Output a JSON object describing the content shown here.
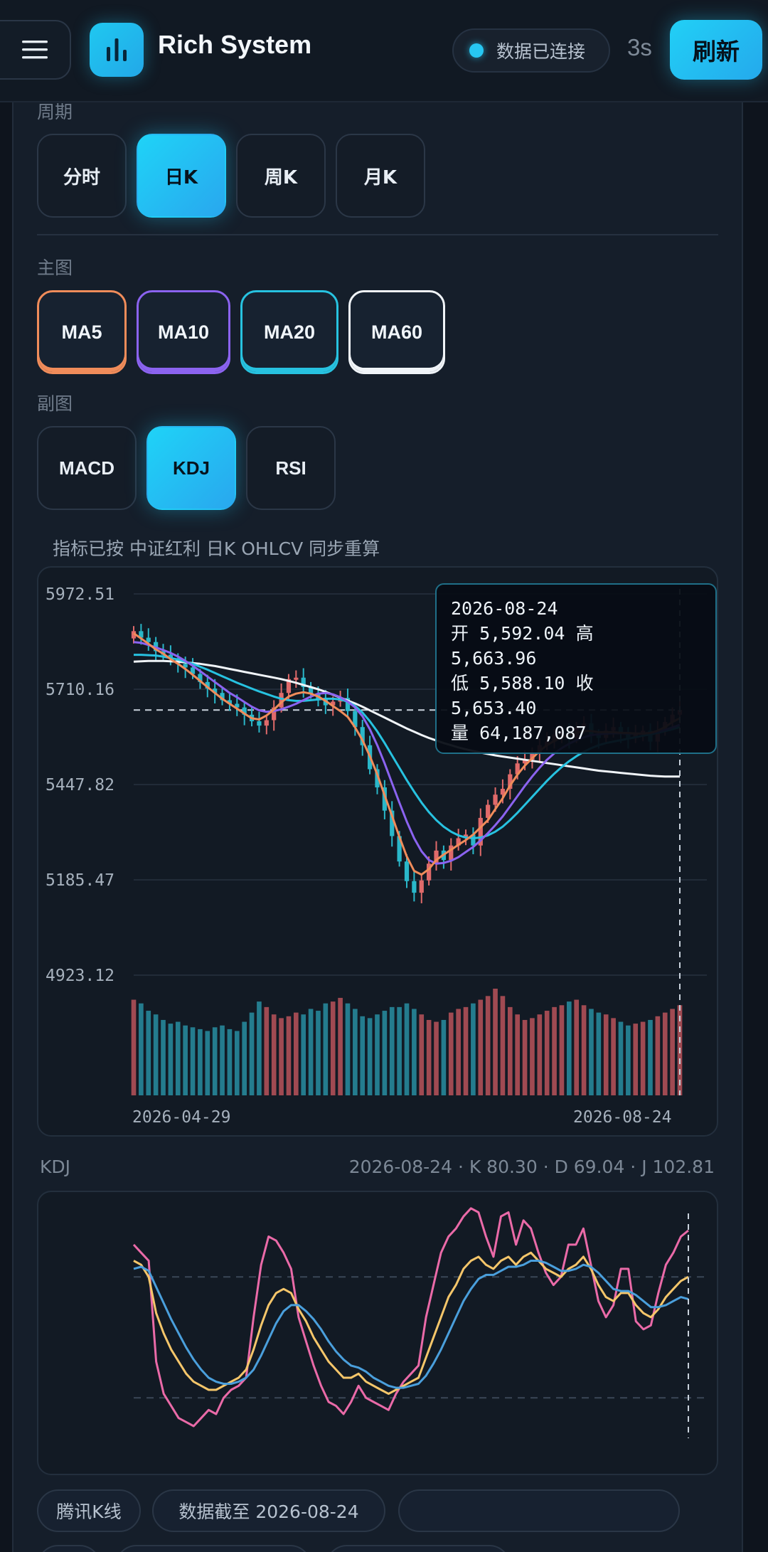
{
  "header": {
    "title": "Rich System",
    "connection_status": "数据已连接",
    "countdown": "3s",
    "refresh_label": "刷新",
    "menu_icon": "hamburger-icon",
    "logo_icon": "bar-chart-icon"
  },
  "period": {
    "label": "周期",
    "options": [
      "分时",
      "日K",
      "周K",
      "月K"
    ],
    "selected": "日K"
  },
  "main_chart": {
    "label": "主图",
    "overlays": [
      {
        "label": "MA5",
        "color": "#f08c5a"
      },
      {
        "label": "MA10",
        "color": "#8b63f0"
      },
      {
        "label": "MA20",
        "color": "#27c2e0"
      },
      {
        "label": "MA60",
        "color": "#f0f4f8"
      }
    ]
  },
  "sub_chart": {
    "label": "副图",
    "options": [
      "MACD",
      "KDJ",
      "RSI"
    ],
    "selected": "KDJ"
  },
  "note": "指标已按 中证红利 日K OHLCV 同步重算",
  "tooltip": {
    "date": "2026-08-24",
    "open_label": "开",
    "open": "5,592.04",
    "high_label": "高",
    "high": "5,663.96",
    "low_label": "低",
    "low": "5,588.10",
    "close_label": "收",
    "close": "5,653.40",
    "volume_label": "量",
    "volume": "64,187,087"
  },
  "kdj": {
    "label": "KDJ",
    "summary": "2026-08-24 · K 80.30 · D 69.04 · J 102.81"
  },
  "footer": {
    "pills": [
      "腾讯K线",
      "数据截至 2026-08-24",
      ""
    ]
  },
  "chart_data": [
    {
      "type": "candlestick",
      "y_ticks": [
        "5972.51",
        "5710.16",
        "5447.82",
        "5185.47",
        "4923.12"
      ],
      "ylim": [
        4923.12,
        5972.51
      ],
      "x_labels": [
        "2026-04-29",
        "2026-08-24"
      ],
      "colors": {
        "up": "#e06a6a",
        "down": "#2ab7c9",
        "ma5": "#f08c5a",
        "ma10": "#8b63f0",
        "ma20": "#27c2e0",
        "ma60": "#f0f4f8"
      },
      "close": [
        5870,
        5852,
        5840,
        5815,
        5805,
        5795,
        5780,
        5770,
        5752,
        5730,
        5712,
        5700,
        5680,
        5670,
        5660,
        5640,
        5622,
        5610,
        5625,
        5660,
        5700,
        5738,
        5742,
        5716,
        5698,
        5682,
        5666,
        5676,
        5686,
        5650,
        5606,
        5556,
        5490,
        5440,
        5376,
        5306,
        5236,
        5182,
        5150,
        5184,
        5230,
        5266,
        5240,
        5280,
        5300,
        5310,
        5280,
        5356,
        5392,
        5420,
        5436,
        5476,
        5506,
        5516,
        5536,
        5556,
        5566,
        5586,
        5590,
        5576,
        5606,
        5616,
        5586,
        5576,
        5596,
        5606,
        5586,
        5576,
        5586,
        5596,
        5566,
        5596,
        5620,
        5640,
        5653
      ],
      "ma5": [
        5864,
        5850,
        5835,
        5820,
        5808,
        5793,
        5780,
        5766,
        5750,
        5733,
        5716,
        5700,
        5684,
        5670,
        5657,
        5643,
        5630,
        5627,
        5638,
        5654,
        5674,
        5690,
        5698,
        5702,
        5698,
        5690,
        5678,
        5664,
        5650,
        5634,
        5605,
        5570,
        5526,
        5476,
        5418,
        5362,
        5304,
        5250,
        5210,
        5200,
        5215,
        5240,
        5255,
        5268,
        5282,
        5295,
        5310,
        5330,
        5350,
        5380,
        5410,
        5445,
        5475,
        5500,
        5520,
        5540,
        5556,
        5568,
        5578,
        5584,
        5590,
        5595,
        5595,
        5592,
        5592,
        5592,
        5590,
        5590,
        5588,
        5588,
        5590,
        5596,
        5606,
        5620,
        5630
      ],
      "ma10": [
        5840,
        5838,
        5832,
        5825,
        5818,
        5810,
        5800,
        5788,
        5775,
        5760,
        5745,
        5730,
        5715,
        5700,
        5688,
        5675,
        5662,
        5652,
        5648,
        5650,
        5655,
        5662,
        5670,
        5680,
        5690,
        5698,
        5700,
        5696,
        5688,
        5676,
        5660,
        5636,
        5600,
        5556,
        5506,
        5452,
        5398,
        5346,
        5300,
        5264,
        5240,
        5230,
        5232,
        5238,
        5248,
        5262,
        5276,
        5294,
        5314,
        5336,
        5360,
        5388,
        5416,
        5444,
        5470,
        5494,
        5516,
        5534,
        5548,
        5560,
        5570,
        5578,
        5584,
        5586,
        5588,
        5589,
        5589,
        5588,
        5588,
        5588,
        5590,
        5593,
        5598,
        5605,
        5612
      ],
      "ma20": [
        5805,
        5805,
        5804,
        5803,
        5800,
        5796,
        5792,
        5786,
        5780,
        5772,
        5764,
        5755,
        5746,
        5737,
        5728,
        5720,
        5712,
        5704,
        5697,
        5690,
        5684,
        5680,
        5678,
        5678,
        5680,
        5682,
        5684,
        5684,
        5682,
        5676,
        5664,
        5646,
        5622,
        5594,
        5562,
        5528,
        5494,
        5460,
        5428,
        5398,
        5372,
        5350,
        5332,
        5318,
        5308,
        5302,
        5300,
        5302,
        5308,
        5318,
        5332,
        5350,
        5370,
        5392,
        5414,
        5436,
        5458,
        5478,
        5496,
        5512,
        5526,
        5538,
        5548,
        5556,
        5562,
        5566,
        5570,
        5574,
        5578,
        5582,
        5586,
        5590,
        5595,
        5600,
        5606
      ],
      "ma60": [
        5786,
        5787,
        5788,
        5788,
        5788,
        5787,
        5786,
        5784,
        5782,
        5780,
        5777,
        5774,
        5770,
        5766,
        5762,
        5758,
        5754,
        5750,
        5746,
        5742,
        5738,
        5733,
        5728,
        5722,
        5716,
        5710,
        5703,
        5695,
        5687,
        5679,
        5671,
        5662,
        5652,
        5642,
        5632,
        5622,
        5612,
        5602,
        5593,
        5584,
        5576,
        5569,
        5562,
        5556,
        5550,
        5545,
        5540,
        5536,
        5532,
        5528,
        5525,
        5522,
        5519,
        5516,
        5513,
        5510,
        5507,
        5504,
        5501,
        5498,
        5495,
        5492,
        5489,
        5486,
        5484,
        5482,
        5480,
        5478,
        5476,
        5474,
        5472,
        5471,
        5470,
        5470,
        5470
      ],
      "volume": [
        52,
        50,
        46,
        44,
        41,
        39,
        40,
        38,
        37,
        36,
        35,
        37,
        38,
        36,
        35,
        40,
        45,
        51,
        48,
        44,
        42,
        43,
        45,
        44,
        47,
        46,
        50,
        51,
        53,
        50,
        47,
        43,
        42,
        44,
        46,
        48,
        48,
        50,
        47,
        44,
        41,
        40,
        41,
        45,
        47,
        48,
        50,
        52,
        54,
        58,
        54,
        48,
        44,
        41,
        42,
        44,
        46,
        48,
        49,
        51,
        52,
        49,
        47,
        45,
        44,
        42,
        40,
        38,
        39,
        40,
        41,
        43,
        45,
        47,
        49
      ]
    },
    {
      "type": "line",
      "title": "KDJ",
      "colors": {
        "K": "#f5c66a",
        "D": "#4a9fdc",
        "J": "#ea6aa8"
      },
      "ref_lines": [
        80,
        20
      ],
      "K": [
        88,
        86,
        80,
        62,
        52,
        44,
        38,
        32,
        28,
        26,
        24,
        24,
        26,
        28,
        30,
        34,
        44,
        56,
        66,
        72,
        74,
        72,
        64,
        58,
        50,
        44,
        38,
        34,
        30,
        30,
        32,
        28,
        26,
        24,
        22,
        24,
        26,
        28,
        30,
        40,
        50,
        60,
        70,
        76,
        84,
        88,
        90,
        86,
        84,
        88,
        90,
        86,
        90,
        92,
        88,
        84,
        82,
        80,
        84,
        86,
        90,
        84,
        76,
        70,
        68,
        72,
        72,
        66,
        62,
        60,
        64,
        70,
        74,
        78,
        80
      ],
      "D": [
        84,
        85,
        83,
        75,
        67,
        59,
        52,
        45,
        39,
        34,
        30,
        28,
        27,
        27,
        28,
        30,
        34,
        41,
        49,
        57,
        63,
        66,
        66,
        63,
        59,
        54,
        48,
        43,
        39,
        36,
        35,
        33,
        30,
        28,
        26,
        25,
        25,
        26,
        27,
        31,
        37,
        44,
        52,
        60,
        68,
        74,
        79,
        81,
        81,
        83,
        85,
        85,
        86,
        88,
        88,
        87,
        85,
        83,
        83,
        84,
        86,
        85,
        82,
        78,
        74,
        73,
        73,
        71,
        68,
        65,
        65,
        66,
        68,
        70,
        69
      ],
      "J": [
        96,
        92,
        88,
        38,
        22,
        16,
        10,
        8,
        6,
        10,
        14,
        12,
        20,
        24,
        26,
        30,
        60,
        86,
        100,
        98,
        92,
        84,
        60,
        48,
        36,
        26,
        18,
        16,
        12,
        18,
        26,
        20,
        18,
        16,
        14,
        22,
        28,
        32,
        36,
        60,
        76,
        92,
        100,
        104,
        110,
        114,
        112,
        100,
        90,
        110,
        112,
        96,
        108,
        104,
        92,
        82,
        76,
        80,
        96,
        96,
        104,
        86,
        68,
        60,
        66,
        84,
        84,
        58,
        54,
        56,
        72,
        86,
        92,
        100,
        103
      ]
    }
  ]
}
